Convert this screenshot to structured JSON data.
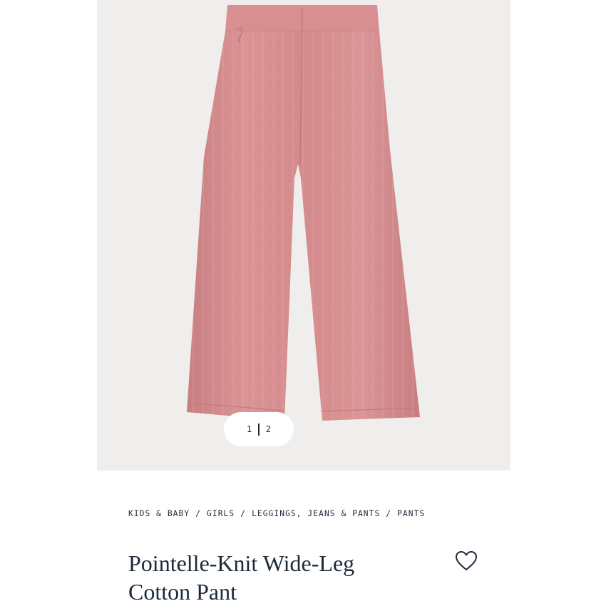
{
  "gallery": {
    "current_index": "1",
    "total_index": "2",
    "image_alt": "Pointelle-Knit Wide-Leg Cotton Pant",
    "background_color": "#efeeec",
    "product_color": "#d98f90"
  },
  "breadcrumb": {
    "items": [
      "KIDS & BABY",
      "GIRLS",
      "LEGGINGS, JEANS & PANTS",
      "PANTS"
    ],
    "separator": "/"
  },
  "product": {
    "title_line1": "Pointelle-Knit Wide-Leg",
    "title_line2": "Cotton Pant",
    "wishlist_icon": "heart-outline-icon"
  },
  "colors": {
    "text": "#1c2a3a",
    "page_background": "#ffffff"
  }
}
